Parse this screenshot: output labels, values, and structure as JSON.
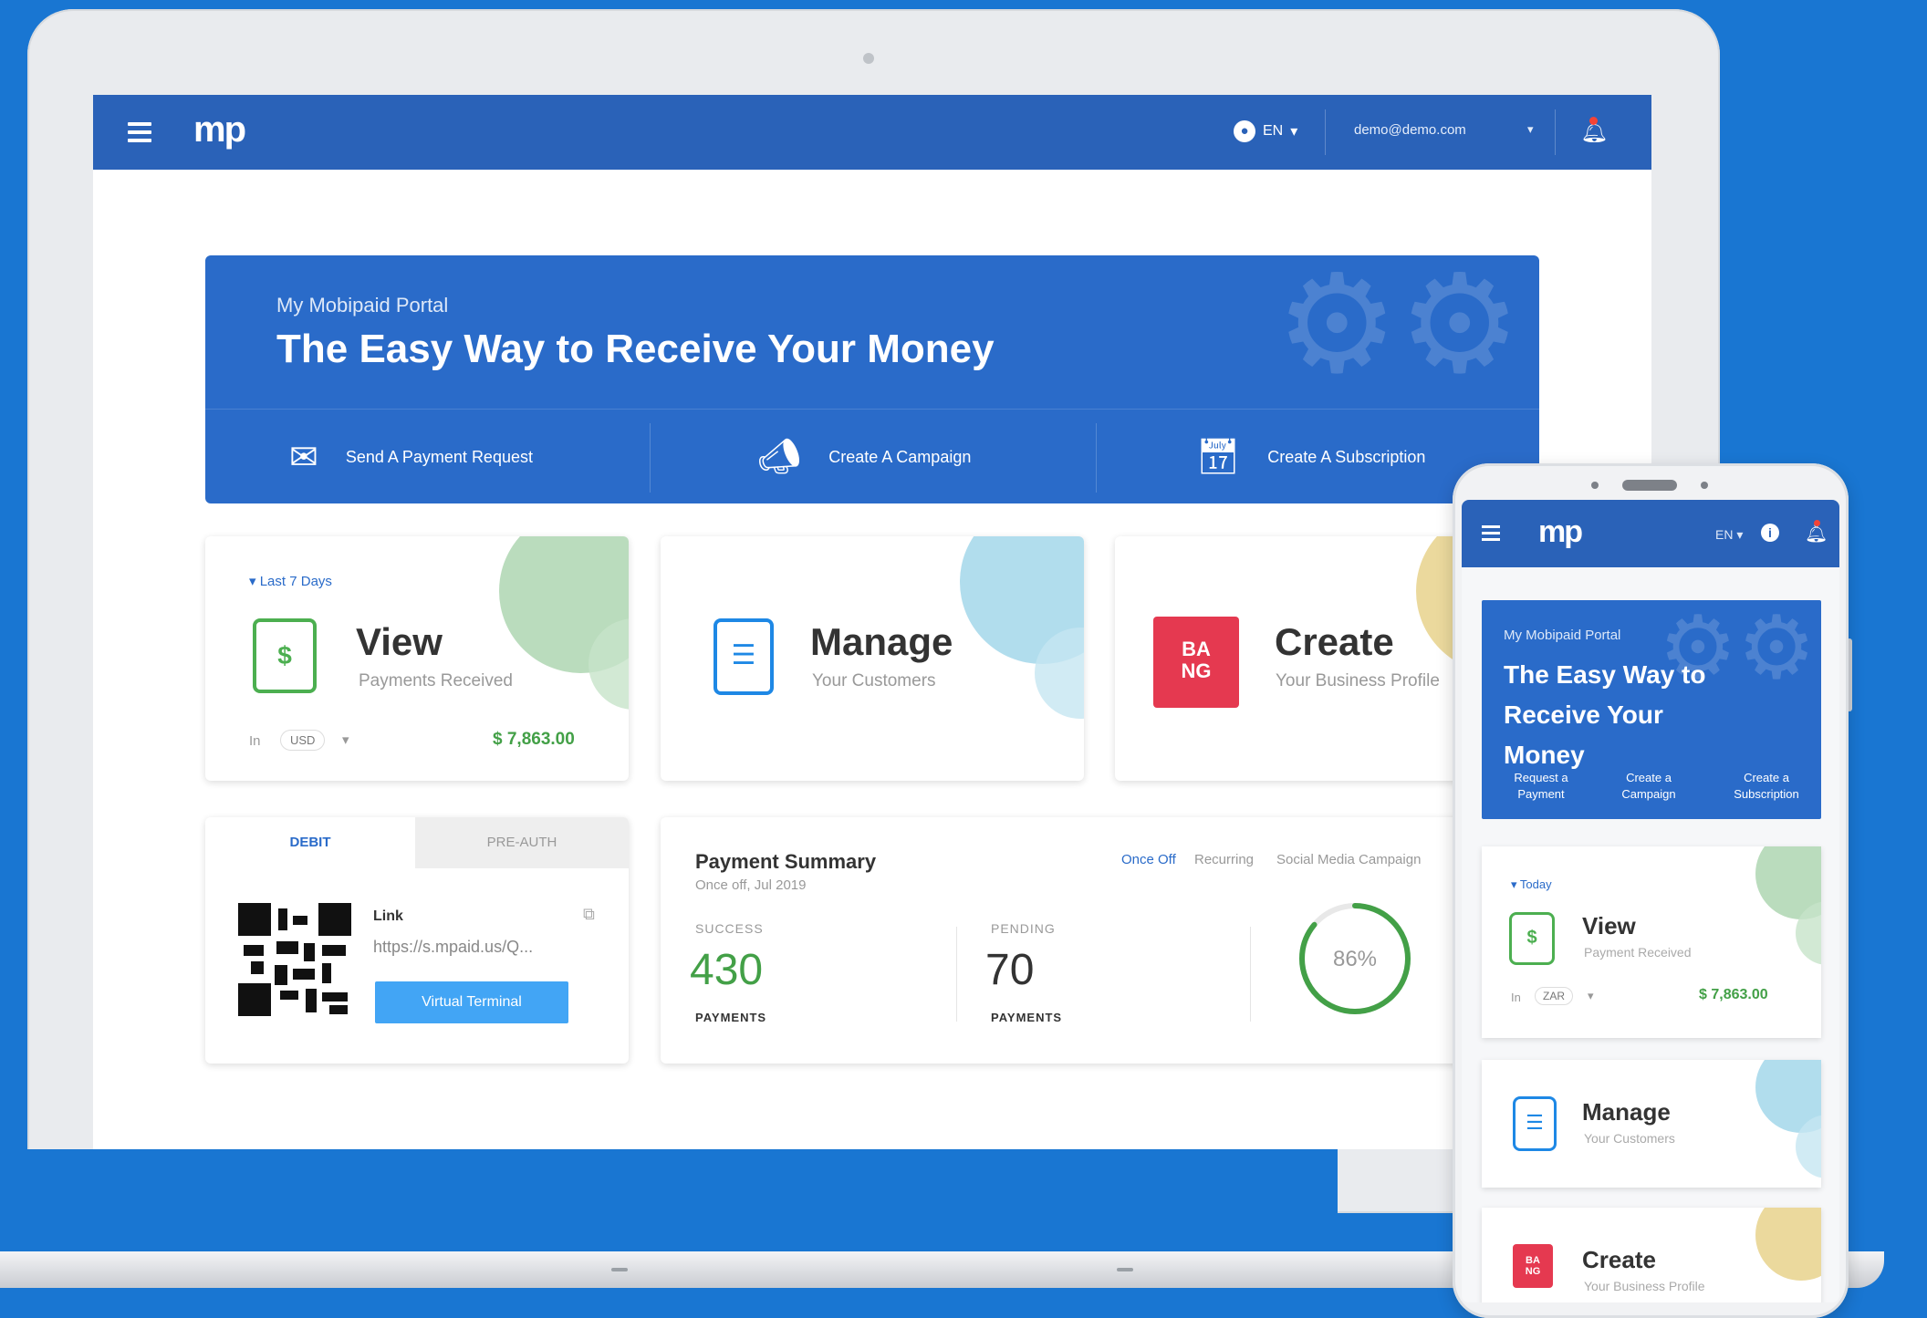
{
  "laptop": {
    "topbar": {
      "logo": "mp",
      "language": "EN",
      "email": "demo@demo.com"
    },
    "hero": {
      "subtitle": "My Mobipaid Portal",
      "title": "The Easy Way to Receive Your Money",
      "actions": [
        {
          "label": "Send A Payment Request",
          "icon": "envelope-icon"
        },
        {
          "label": "Create A Campaign",
          "icon": "megaphone-icon"
        },
        {
          "label": "Create A Subscription",
          "icon": "calendar-icon"
        }
      ]
    },
    "cards": {
      "view": {
        "period": "Last 7 Days",
        "title": "View",
        "subtitle": "Payments Received",
        "prefix": "In",
        "currency": "USD",
        "amount": "$ 7,863.00"
      },
      "manage": {
        "title": "Manage",
        "subtitle": "Your Customers"
      },
      "create": {
        "title": "Create",
        "subtitle": "Your Business Profile",
        "logo_text": "BANG"
      }
    },
    "link_card": {
      "tabs": [
        "DEBIT",
        "PRE-AUTH"
      ],
      "link_label": "Link",
      "link_url": "https://s.mpaid.us/Q...",
      "button": "Virtual Terminal"
    },
    "summary": {
      "title": "Payment Summary",
      "subtitle": "Once off, Jul 2019",
      "filters": [
        "Once Off",
        "Recurring",
        "Social Media Campaign"
      ],
      "success_label": "SUCCESS",
      "success_value": "430",
      "pending_label": "PENDING",
      "pending_value": "70",
      "unit": "PAYMENTS",
      "percent": "86%",
      "percent_value": 86
    }
  },
  "phone": {
    "topbar": {
      "logo": "mp",
      "language": "EN"
    },
    "hero": {
      "subtitle": "My Mobipaid Portal",
      "title": "The Easy Way to Receive Your Money",
      "actions": [
        "Request a Payment",
        "Create a Campaign",
        "Create a Subscription"
      ]
    },
    "view": {
      "period": "Today",
      "title": "View",
      "subtitle": "Payment Received",
      "prefix": "In",
      "currency": "ZAR",
      "amount": "$ 7,863.00"
    },
    "manage": {
      "title": "Manage",
      "subtitle": "Your Customers"
    },
    "create": {
      "title": "Create",
      "subtitle": "Your Business Profile"
    }
  },
  "colors": {
    "background": "#1976d2",
    "topbar": "#2a62b8",
    "hero": "#2a6bc9",
    "success": "#43a047",
    "button": "#42a5f5",
    "bang": "#e53950"
  }
}
